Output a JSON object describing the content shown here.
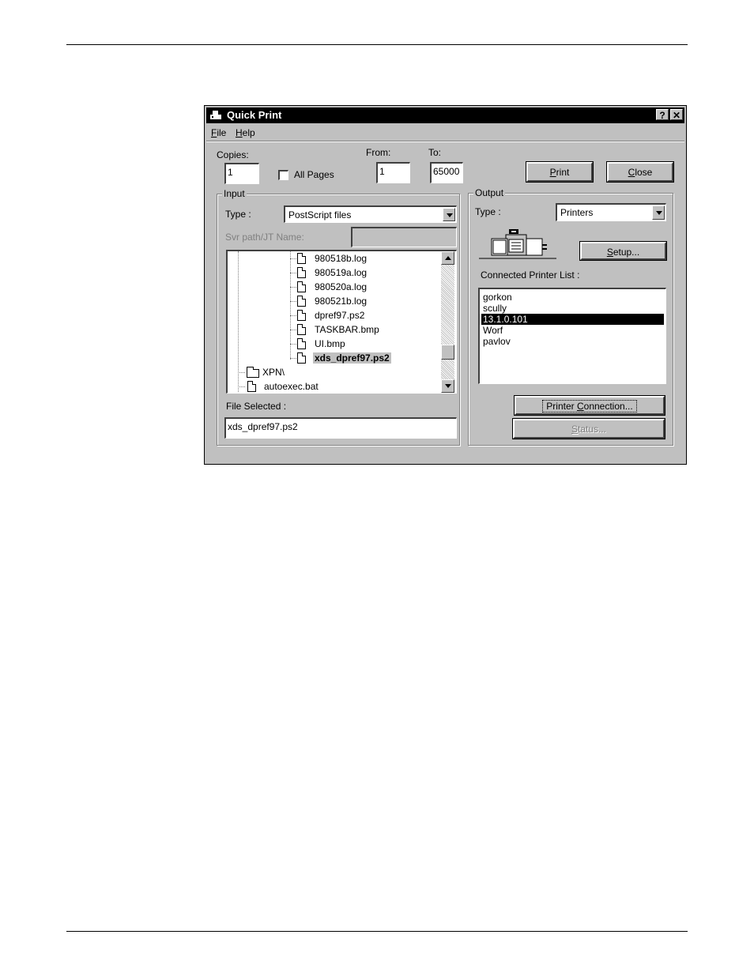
{
  "window": {
    "title": "Quick Print",
    "help_glyph": "?",
    "close_glyph": "✕"
  },
  "menu": {
    "file": {
      "mnemonic": "F",
      "rest": "ile"
    },
    "help": {
      "mnemonic": "H",
      "rest": "elp"
    }
  },
  "copies": {
    "label": "Copies:",
    "value": "1"
  },
  "all_pages": {
    "label": "All Pages",
    "checked": false
  },
  "from": {
    "label": "From:",
    "value": "1"
  },
  "to": {
    "label": "To:",
    "value": "65000"
  },
  "print_button": {
    "mnemonic": "P",
    "rest": "rint"
  },
  "close_button": {
    "mnemonic": "C",
    "rest": "lose"
  },
  "input": {
    "title": "Input",
    "type_label": "Type :",
    "type_value": "PostScript files",
    "svr_label": "Svr path/JT Name:",
    "svr_value": "",
    "tree": {
      "files": [
        "980518b.log",
        "980519a.log",
        "980520a.log",
        "980521b.log",
        "dpref97.ps2",
        "TASKBAR.bmp",
        "UI.bmp",
        "xds_dpref97.ps2"
      ],
      "folder": "XPN\\",
      "root_file": "autoexec.bat",
      "selected": "xds_dpref97.ps2"
    },
    "file_selected_label": "File Selected :",
    "file_selected_value": "xds_dpref97.ps2"
  },
  "output": {
    "title": "Output",
    "type_label": "Type :",
    "type_value": "Printers",
    "setup_button": {
      "mnemonic": "S",
      "rest": "etup..."
    },
    "printer_list_label": "Connected Printer List :",
    "printers": [
      "gorkon",
      "scully",
      "13.1.0.101",
      "Worf",
      "pavlov"
    ],
    "selected_printer": "13.1.0.101",
    "printer_connection_button": {
      "pre": "Printer ",
      "mnemonic": "C",
      "rest": "onnection..."
    },
    "status_button": {
      "mnemonic": "S",
      "rest": "tatus..."
    }
  },
  "icons": [
    "app-printer-icon",
    "help-icon",
    "close-icon",
    "printer-icon",
    "document-icon",
    "folder-icon"
  ]
}
